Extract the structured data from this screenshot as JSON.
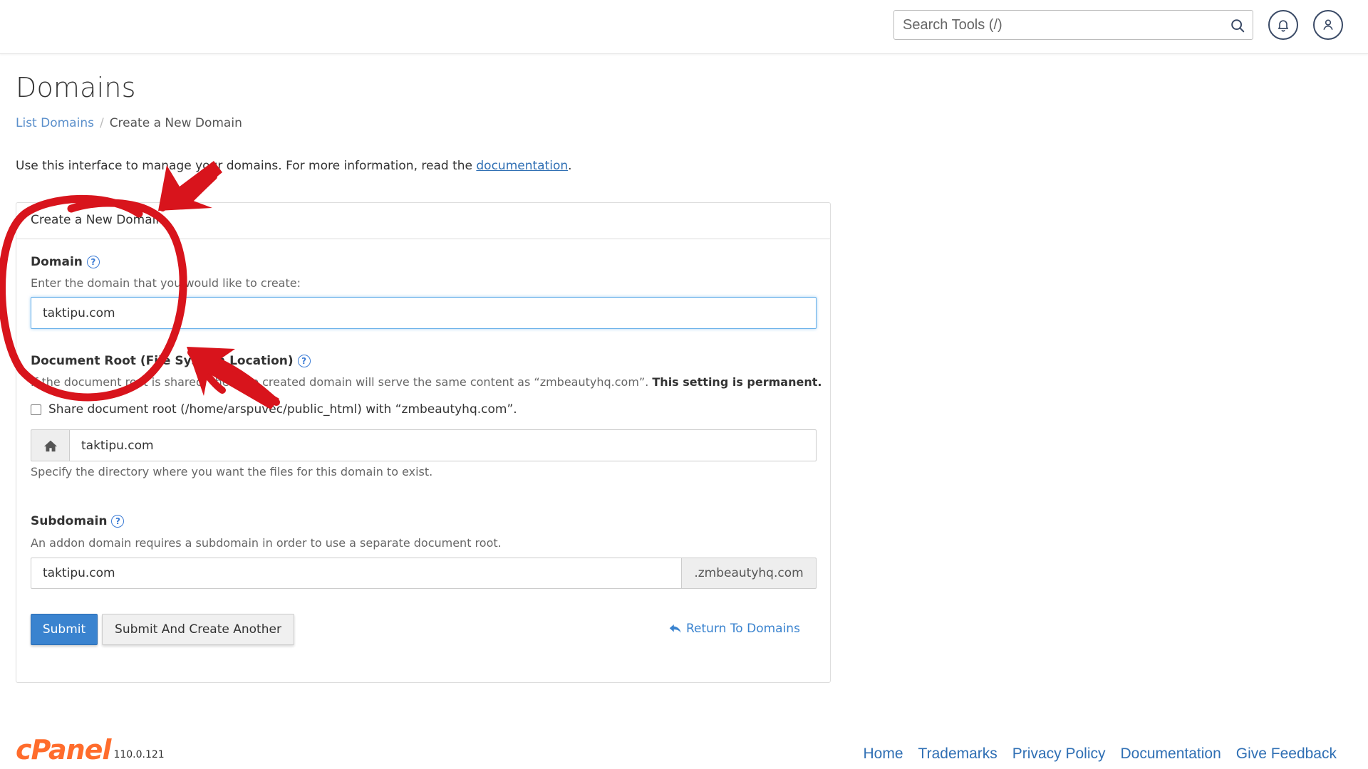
{
  "topbar": {
    "search_placeholder": "Search Tools (/)",
    "search_icon": "search-icon",
    "notifications_icon": "bell-icon",
    "user_icon": "user-icon"
  },
  "page": {
    "title": "Domains",
    "breadcrumb": {
      "parent": "List Domains",
      "current": "Create a New Domain"
    },
    "intro_prefix": "Use this interface to manage your domains. For more information, read the ",
    "intro_link": "documentation",
    "intro_suffix": "."
  },
  "panel": {
    "heading": "Create a New Domain",
    "domain": {
      "label": "Domain",
      "hint": "Enter the domain that you would like to create:",
      "value": "taktipu.com"
    },
    "docroot": {
      "label": "Document Root (File System Location)",
      "hint": "If the document root is shared, then the created domain will serve the same content as “zmbeautyhq.com”.",
      "hint_strong": "This setting is permanent.",
      "checkbox_label": "Share document root (/home/arspuvec/public_html) with “zmbeautyhq.com”.",
      "value": "taktipu.com",
      "help_text": "Specify the directory where you want the files for this domain to exist.",
      "home_icon": "home-icon"
    },
    "subdomain": {
      "label": "Subdomain",
      "hint": "An addon domain requires a subdomain in order to use a separate document root.",
      "value": "taktipu.com",
      "suffix": ".zmbeautyhq.com"
    },
    "buttons": {
      "submit": "Submit",
      "submit_another": "Submit And Create Another",
      "return": "Return To Domains"
    }
  },
  "footer": {
    "brand": "cPanel",
    "version": "110.0.121",
    "links": [
      "Home",
      "Trademarks",
      "Privacy Policy",
      "Documentation",
      "Give Feedback"
    ]
  },
  "colors": {
    "accent": "#3a83cf",
    "link": "#2f6fb4",
    "brand": "#ff6c2c",
    "annotation": "#d8141c"
  }
}
